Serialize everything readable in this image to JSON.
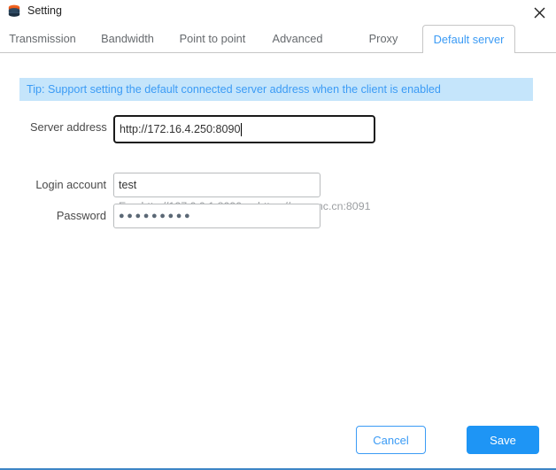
{
  "window": {
    "title": "Setting",
    "app_icon": "layers-stack-icon",
    "close_icon": "close-icon",
    "accent_color": "#3b9bf5",
    "bottom_border_color": "#3d85c6"
  },
  "tabs": [
    {
      "label": "Transmission",
      "active": false,
      "name": "tab-transmission"
    },
    {
      "label": "Bandwidth",
      "active": false,
      "name": "tab-bandwidth"
    },
    {
      "label": "Point to point",
      "active": false,
      "name": "tab-point-to-point"
    },
    {
      "label": "Advanced",
      "active": false,
      "name": "tab-advanced"
    },
    {
      "label": "Proxy",
      "active": false,
      "name": "tab-proxy"
    },
    {
      "label": "Default server",
      "active": true,
      "name": "tab-default-server"
    }
  ],
  "tip": {
    "text": "Tip: Support setting the default connected server address when the client is enabled",
    "background": "#c5e5fb",
    "color": "#3b9bf5"
  },
  "form": {
    "server_address": {
      "label": "Server address",
      "value": "http://172.16.4.250:8090",
      "placeholder": "",
      "focused": true
    },
    "hint": "E.g: http://127.0.0.1:8090 or https://raysync.cn:8091",
    "login_account": {
      "label": "Login account",
      "value": "test",
      "placeholder": ""
    },
    "password": {
      "label": "Password",
      "value": "●●●●●●●●●",
      "placeholder": ""
    }
  },
  "footer": {
    "cancel_label": "Cancel",
    "save_label": "Save"
  }
}
